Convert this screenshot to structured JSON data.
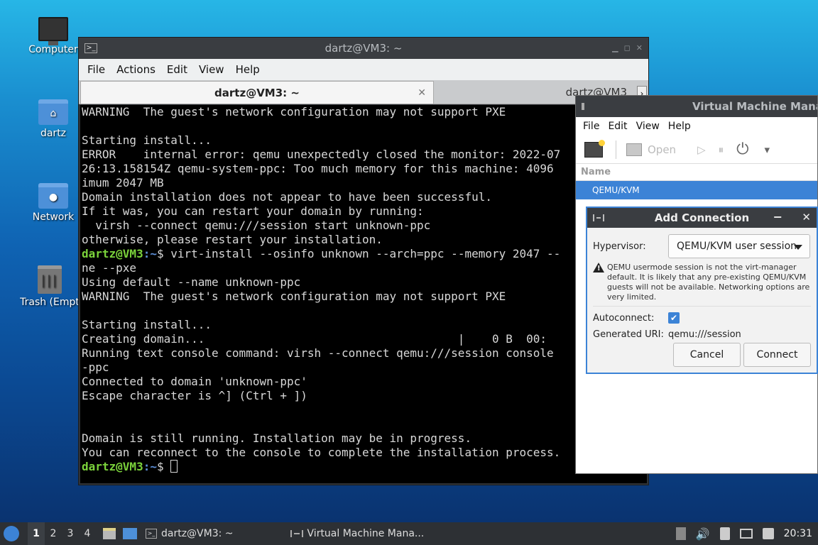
{
  "desktop": {
    "icons": [
      {
        "label": "Computer",
        "icon": "computer-icon"
      },
      {
        "label": "dartz",
        "icon": "home-folder-icon"
      },
      {
        "label": "Network",
        "icon": "network-folder-icon"
      },
      {
        "label": "Trash (Empt",
        "icon": "trash-icon"
      }
    ]
  },
  "terminal": {
    "title": "dartz@VM3: ~",
    "menu": [
      "File",
      "Actions",
      "Edit",
      "View",
      "Help"
    ],
    "tabs": [
      {
        "label": "dartz@VM3: ~",
        "active": true
      },
      {
        "label": "dartz@VM3",
        "active": false
      }
    ],
    "prompt_user": "dartz@VM3",
    "prompt_path": ":~",
    "prompt_symbol": "$ ",
    "lines": [
      "WARNING  The guest's network configuration may not support PXE",
      "",
      "Starting install...",
      "ERROR    internal error: qemu unexpectedly closed the monitor: 2022-07",
      "26:13.158154Z qemu-system-ppc: Too much memory for this machine: 4096",
      "imum 2047 MB",
      "Domain installation does not appear to have been successful.",
      "If it was, you can restart your domain by running:",
      "  virsh --connect qemu:///session start unknown-ppc",
      "otherwise, please restart your installation."
    ],
    "command": "virt-install --osinfo unknown --arch=ppc --memory 2047 --",
    "lines2": [
      "ne --pxe",
      "Using default --name unknown-ppc",
      "WARNING  The guest's network configuration may not support PXE",
      "",
      "Starting install...",
      "Creating domain...                                     |    0 B  00:",
      "Running text console command: virsh --connect qemu:///session console",
      "-ppc",
      "Connected to domain 'unknown-ppc'",
      "Escape character is ^] (Ctrl + ])",
      "",
      "",
      "Domain is still running. Installation may be in progress.",
      "You can reconnect to the console to complete the installation process."
    ]
  },
  "vmm": {
    "title": "Virtual Machine Mana",
    "menu": [
      "File",
      "Edit",
      "View",
      "Help"
    ],
    "toolbar": {
      "open_label": "Open"
    },
    "column_header": "Name",
    "rows": [
      "QEMU/KVM"
    ]
  },
  "dialog": {
    "title": "Add Connection",
    "minimize": "−",
    "close": "✕",
    "hypervisor_label": "Hypervisor:",
    "hypervisor_value": "QEMU/KVM user session",
    "warning": "QEMU usermode session is not the virt-manager default. It is likely that any pre-existing QEMU/KVM guests will not be available. Networking options are very limited.",
    "autoconnect_label": "Autoconnect:",
    "autoconnect_checked": true,
    "uri_label": "Generated URI:",
    "uri_value": "qemu:///session",
    "cancel_label": "Cancel",
    "connect_label": "Connect"
  },
  "taskbar": {
    "workspaces": [
      "1",
      "2",
      "3",
      "4"
    ],
    "tasks": [
      "dartz@VM3: ~",
      "Virtual Machine Mana..."
    ],
    "clock": "20:31"
  }
}
